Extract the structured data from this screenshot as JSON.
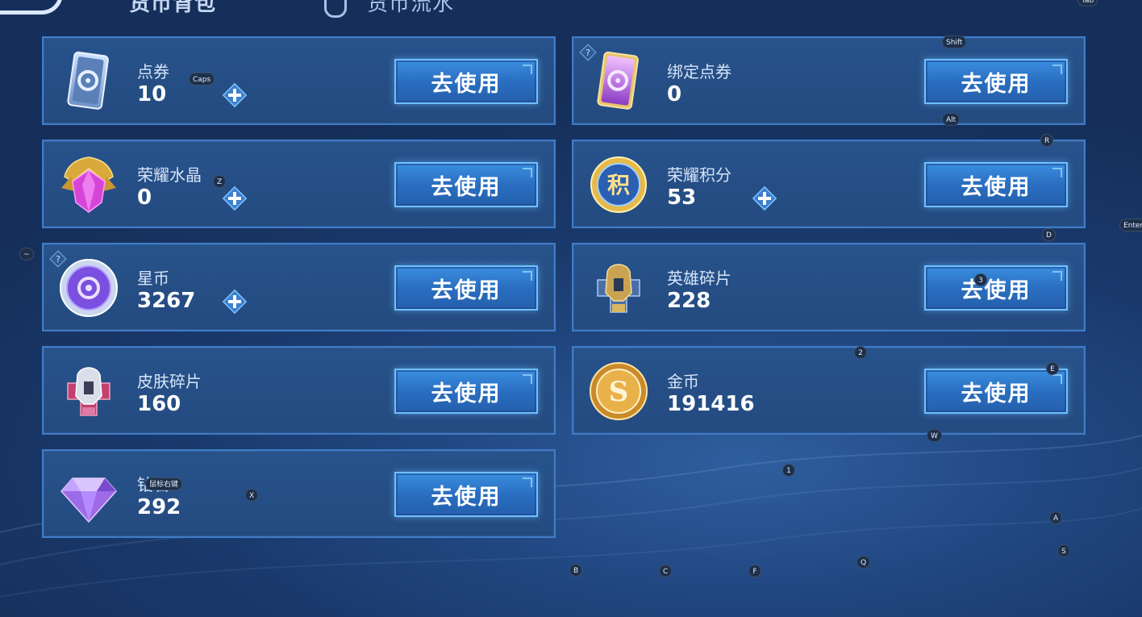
{
  "header": {
    "tab_bag": "货币背包",
    "tab_flow": "货币流水"
  },
  "items": [
    {
      "name": "点券",
      "value": "10",
      "button": "去使用"
    },
    {
      "name": "绑定点券",
      "value": "0",
      "button": "去使用"
    },
    {
      "name": "荣耀水晶",
      "value": "0",
      "button": "去使用"
    },
    {
      "name": "荣耀积分",
      "value": "53",
      "button": "去使用"
    },
    {
      "name": "星币",
      "value": "3267",
      "button": "去使用"
    },
    {
      "name": "英雄碎片",
      "value": "228",
      "button": "去使用"
    },
    {
      "name": "皮肤碎片",
      "value": "160",
      "button": "去使用"
    },
    {
      "name": "金币",
      "value": "191416",
      "button": "去使用"
    },
    {
      "name": "钻石",
      "value": "292",
      "button": "去使用"
    }
  ],
  "icon_names": [
    "coupon-icon",
    "bound-coupon-icon",
    "glory-crystal-icon",
    "glory-points-icon",
    "star-coin-icon",
    "hero-shard-icon",
    "skin-shard-icon",
    "gold-coin-icon",
    "diamond-icon"
  ],
  "keyboard_hints": {
    "tab": "Tab",
    "shift": "Shift",
    "caps": "Caps",
    "alt": "Alt",
    "r": "R",
    "z": "Z",
    "d": "D",
    "enter": "Enter",
    "tilde": "~",
    "three": "3",
    "two": "2",
    "e": "E",
    "w": "W",
    "one": "1",
    "mouse_right": "鼠标右键",
    "x": "X",
    "a": "A",
    "s": "S",
    "q": "Q",
    "b": "B",
    "c": "C",
    "f": "F"
  },
  "colors": {
    "card_bg": "#244b80",
    "card_border": "#3f7bc7",
    "button_bg": "#2a6ec0",
    "button_border": "#6fc0ff",
    "background": "#1a3a6d"
  }
}
